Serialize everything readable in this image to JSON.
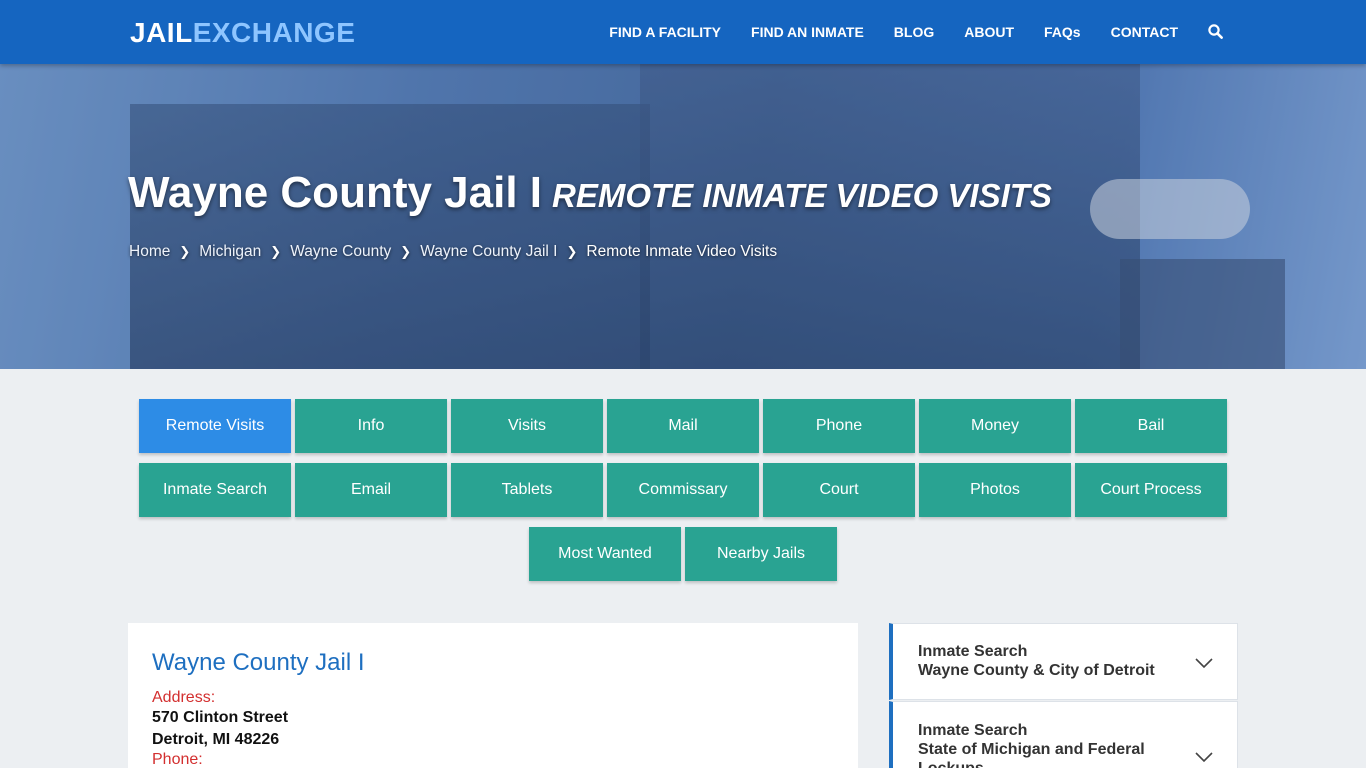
{
  "logo": {
    "part1": "JAIL",
    "part2": "EXCHANGE"
  },
  "nav": {
    "items": [
      "FIND A FACILITY",
      "FIND AN INMATE",
      "BLOG",
      "ABOUT",
      "FAQs",
      "CONTACT"
    ],
    "search_icon": "search-icon"
  },
  "hero": {
    "title": "Wayne County Jail I",
    "subtitle": "REMOTE INMATE VIDEO VISITS",
    "breadcrumbs": [
      "Home",
      "Michigan",
      "Wayne County",
      "Wayne County Jail I"
    ],
    "breadcrumb_current": "Remote Inmate Video Visits"
  },
  "tabs": {
    "row1": [
      "Remote Visits",
      "Info",
      "Visits",
      "Mail",
      "Phone",
      "Money",
      "Bail"
    ],
    "row2": [
      "Inmate Search",
      "Email",
      "Tablets",
      "Commissary",
      "Court",
      "Photos",
      "Court Process"
    ],
    "row3": [
      "Most Wanted",
      "Nearby Jails"
    ],
    "active": "Remote Visits"
  },
  "facility": {
    "name": "Wayne County Jail I",
    "address_label": "Address:",
    "address_line1": "570 Clinton Street",
    "address_line2": "Detroit, MI 48226",
    "phone_label": "Phone:"
  },
  "sidebar": {
    "items": [
      {
        "line1": "Inmate Search",
        "line2": "Wayne County & City of Detroit"
      },
      {
        "line1": "Inmate Search",
        "line2": "State of Michigan and Federal Lockups"
      }
    ]
  },
  "colors": {
    "header": "#1565c0",
    "tab": "#29a392",
    "tab_active": "#2d8ce6",
    "link_blue": "#1e6fc0",
    "label_red": "#d32f2f"
  }
}
